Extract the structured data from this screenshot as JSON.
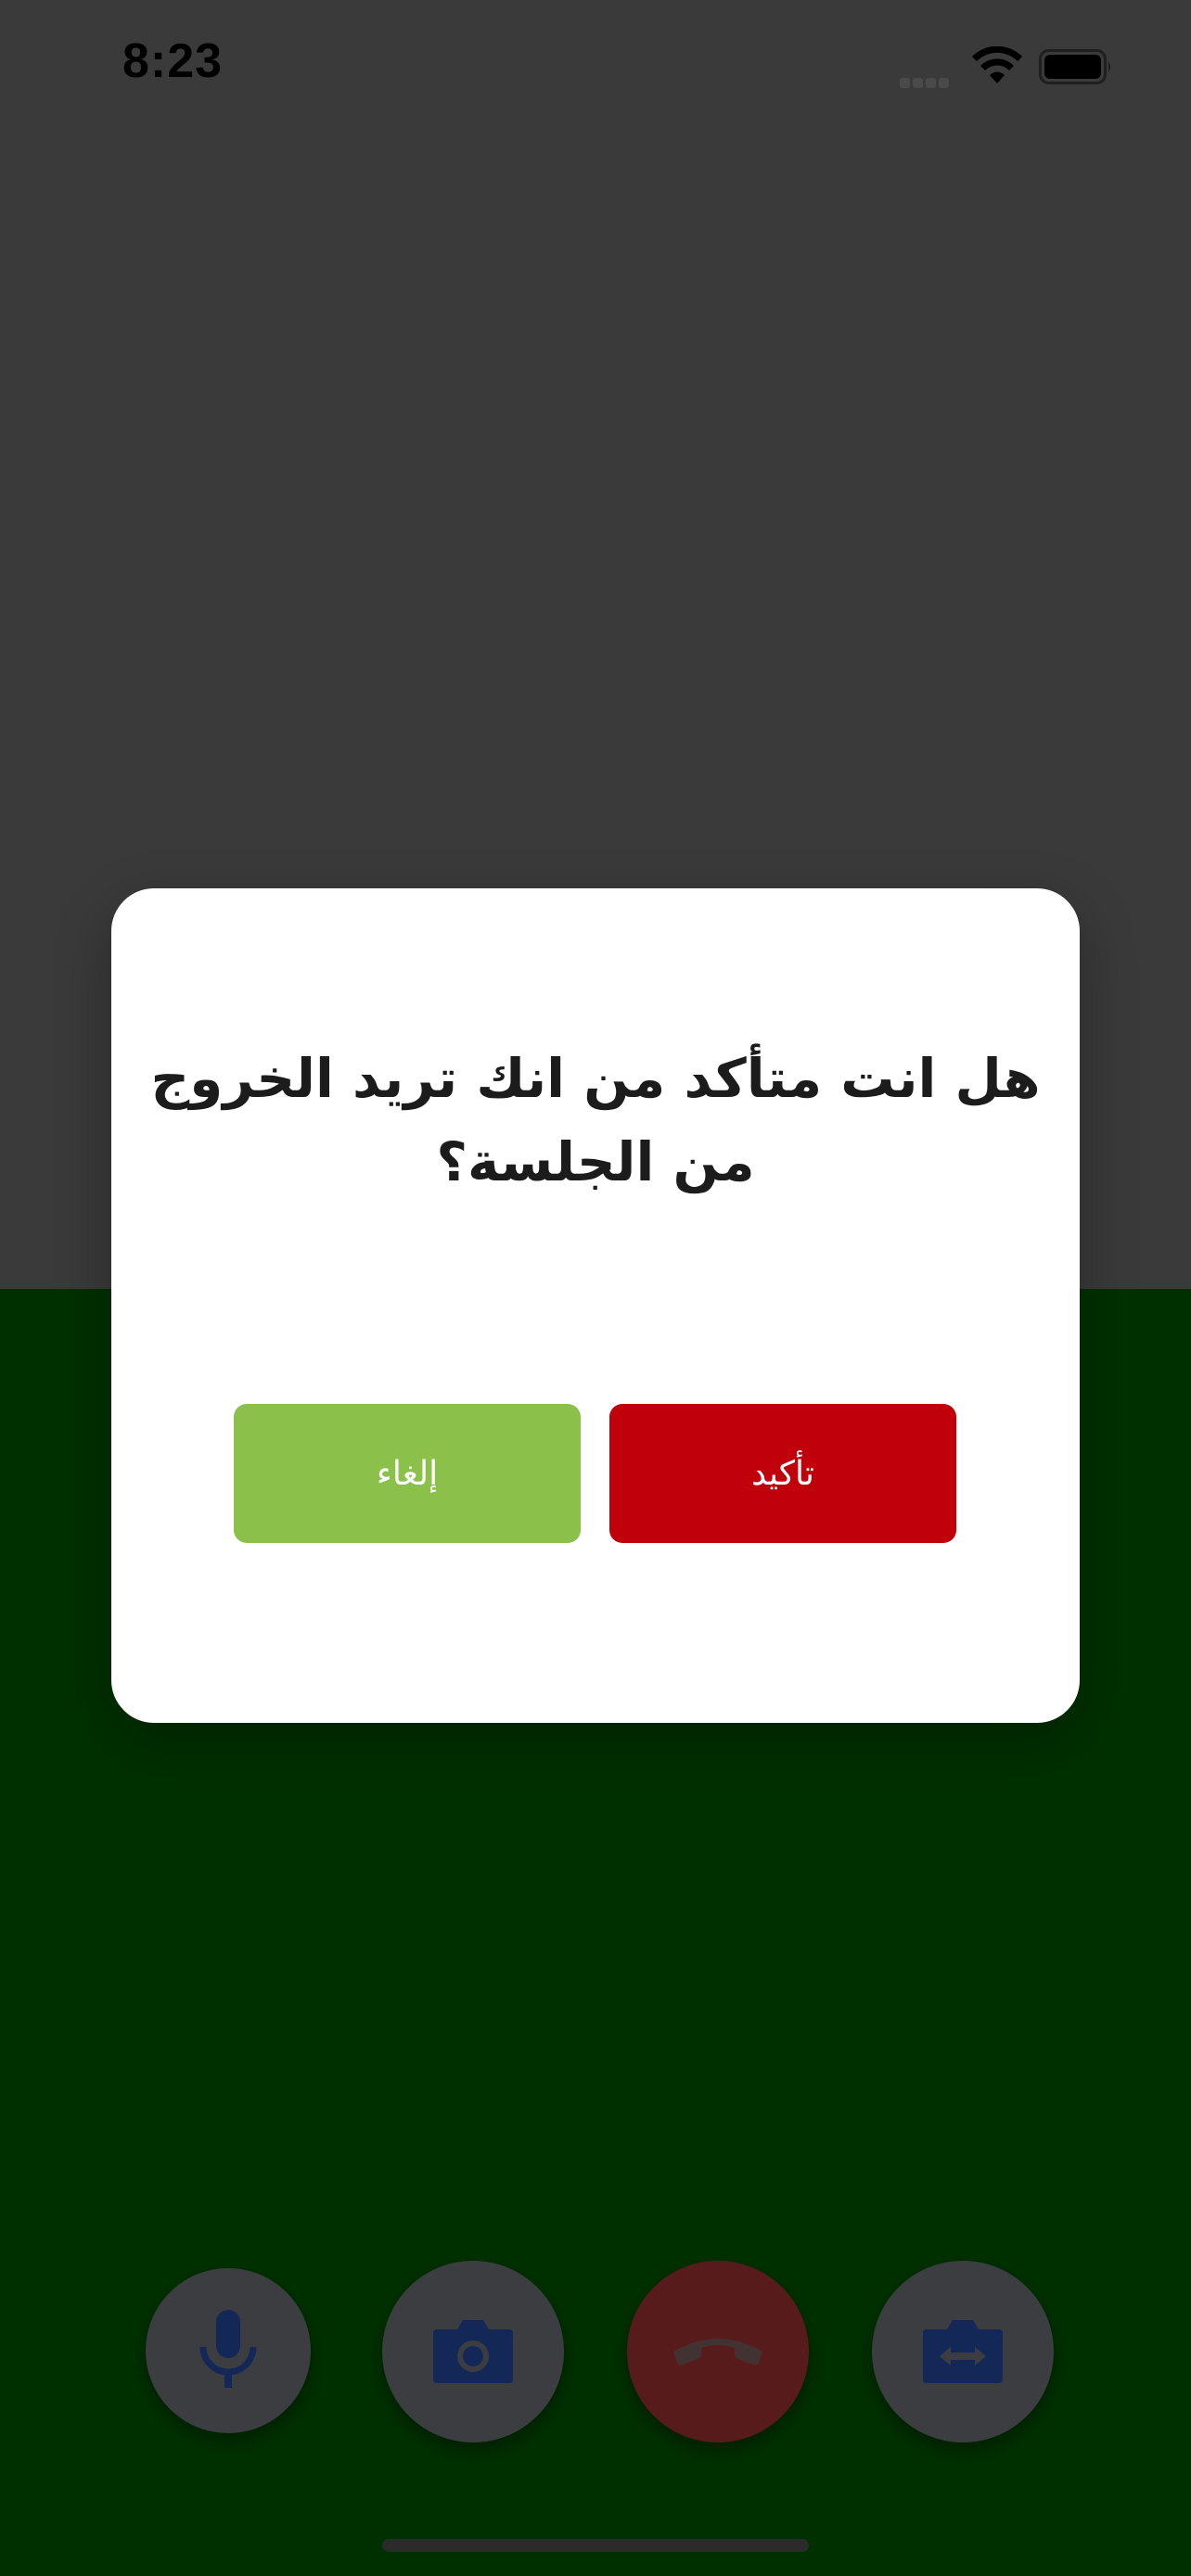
{
  "colors": {
    "top_background": "#7a7a7a",
    "bottom_background": "#006400",
    "overlay": "#000000",
    "modal_background": "#ffffff",
    "confirm_button": "#c0000a",
    "cancel_button": "#8bc04b",
    "control_button": "#7b7f86",
    "end_call_button": "#b83a3a",
    "control_icon": "#2a54b8",
    "home_indicator": "#5a5a5a"
  },
  "status_bar": {
    "time": "8:23",
    "icons": [
      "cellular-signal-icon",
      "wifi-icon",
      "battery-icon"
    ]
  },
  "dialog": {
    "message": "هل انت متأكد من انك تريد الخروج من الجلسة؟",
    "cancel_label": "إلغاء",
    "confirm_label": "تأكيد"
  },
  "call_controls": [
    {
      "icon": "microphone-icon"
    },
    {
      "icon": "camera-icon"
    },
    {
      "icon": "end-call-icon"
    },
    {
      "icon": "switch-camera-icon"
    }
  ]
}
